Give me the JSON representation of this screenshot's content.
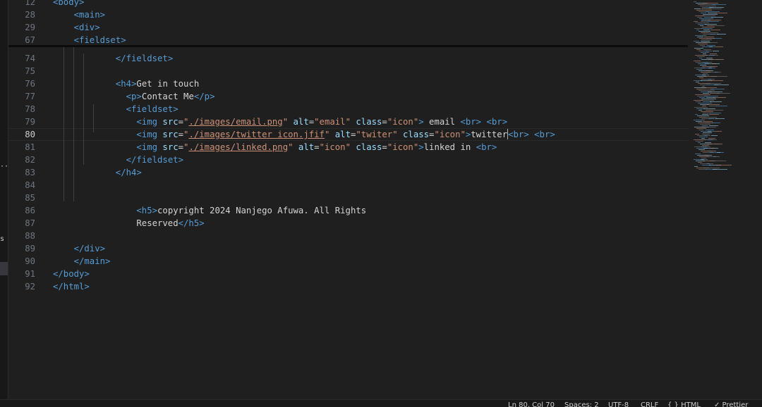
{
  "sticky_scroll": [
    {
      "ln": "12",
      "parts": [
        {
          "c": "t",
          "s": "<body>"
        }
      ]
    },
    {
      "ln": "28",
      "parts": [
        {
          "c": "t",
          "s": "<main>"
        }
      ]
    },
    {
      "ln": "29",
      "parts": [
        {
          "c": "t",
          "s": "<div>"
        }
      ]
    },
    {
      "ln": "67",
      "parts": [
        {
          "c": "t",
          "s": "<fieldset>"
        }
      ]
    }
  ],
  "lines": [
    {
      "ln": "74",
      "indent": 6,
      "parts": [
        {
          "c": "t",
          "s": "</fieldset>"
        }
      ]
    },
    {
      "ln": "75",
      "indent": 0,
      "parts": []
    },
    {
      "ln": "76",
      "indent": 6,
      "parts": [
        {
          "c": "t",
          "s": "<h4>"
        },
        {
          "c": "txt",
          "s": "Get in touch"
        }
      ]
    },
    {
      "ln": "77",
      "indent": 7,
      "parts": [
        {
          "c": "t",
          "s": "<p>"
        },
        {
          "c": "txt",
          "s": "Contact Me"
        },
        {
          "c": "t",
          "s": "</p>"
        }
      ]
    },
    {
      "ln": "78",
      "indent": 7,
      "parts": [
        {
          "c": "t",
          "s": "<fieldset>"
        }
      ]
    },
    {
      "ln": "79",
      "indent": 8,
      "parts": [
        {
          "c": "t",
          "s": "<img "
        },
        {
          "c": "a",
          "s": "src"
        },
        {
          "c": "txt",
          "s": "="
        },
        {
          "c": "v",
          "s": "\""
        },
        {
          "c": "v u",
          "s": "./images/email.png"
        },
        {
          "c": "v",
          "s": "\""
        },
        {
          "c": "a",
          "s": " alt"
        },
        {
          "c": "txt",
          "s": "="
        },
        {
          "c": "v",
          "s": "\"email\""
        },
        {
          "c": "a",
          "s": " class"
        },
        {
          "c": "txt",
          "s": "="
        },
        {
          "c": "v",
          "s": "\"icon\""
        },
        {
          "c": "t",
          "s": ">"
        },
        {
          "c": "txt",
          "s": " email "
        },
        {
          "c": "t",
          "s": "<br>"
        },
        {
          "c": "txt",
          "s": " "
        },
        {
          "c": "t",
          "s": "<br>"
        }
      ]
    },
    {
      "ln": "80",
      "indent": 8,
      "active": true,
      "parts": [
        {
          "c": "t",
          "s": "<img "
        },
        {
          "c": "a",
          "s": "src"
        },
        {
          "c": "txt",
          "s": "="
        },
        {
          "c": "v",
          "s": "\""
        },
        {
          "c": "v u",
          "s": "./images/twitter icon.jfif"
        },
        {
          "c": "v",
          "s": "\""
        },
        {
          "c": "a",
          "s": " alt"
        },
        {
          "c": "txt",
          "s": "="
        },
        {
          "c": "v",
          "s": "\"twiter\""
        },
        {
          "c": "a",
          "s": " class"
        },
        {
          "c": "txt",
          "s": "="
        },
        {
          "c": "v",
          "s": "\"icon\""
        },
        {
          "c": "t",
          "s": ">"
        },
        {
          "c": "txt",
          "s": "twitter"
        },
        {
          "c": "cursor",
          "s": ""
        },
        {
          "c": "t",
          "s": "<br>"
        },
        {
          "c": "txt",
          "s": " "
        },
        {
          "c": "t",
          "s": "<br>"
        }
      ]
    },
    {
      "ln": "81",
      "indent": 8,
      "parts": [
        {
          "c": "t",
          "s": "<img "
        },
        {
          "c": "a",
          "s": "src"
        },
        {
          "c": "txt",
          "s": "="
        },
        {
          "c": "v",
          "s": "\""
        },
        {
          "c": "v u",
          "s": "./images/linked.png"
        },
        {
          "c": "v",
          "s": "\""
        },
        {
          "c": "a",
          "s": " alt"
        },
        {
          "c": "txt",
          "s": "="
        },
        {
          "c": "v",
          "s": "\"icon\""
        },
        {
          "c": "a",
          "s": " class"
        },
        {
          "c": "txt",
          "s": "="
        },
        {
          "c": "v",
          "s": "\"icon\""
        },
        {
          "c": "t",
          "s": ">"
        },
        {
          "c": "txt",
          "s": "linked in "
        },
        {
          "c": "t",
          "s": "<br>"
        }
      ]
    },
    {
      "ln": "82",
      "indent": 7,
      "parts": [
        {
          "c": "t",
          "s": "</fieldset>"
        }
      ]
    },
    {
      "ln": "83",
      "indent": 6,
      "parts": [
        {
          "c": "t",
          "s": "</h4>"
        }
      ]
    },
    {
      "ln": "84",
      "indent": 0,
      "parts": []
    },
    {
      "ln": "85",
      "indent": 0,
      "parts": []
    },
    {
      "ln": "86",
      "indent": 8,
      "parts": [
        {
          "c": "t",
          "s": "<h5>"
        },
        {
          "c": "txt",
          "s": "copyright 2024 Nanjego Afuwa. All Rights"
        }
      ]
    },
    {
      "ln": "87",
      "indent": 8,
      "parts": [
        {
          "c": "txt",
          "s": "Reserved"
        },
        {
          "c": "t",
          "s": "</h5>"
        }
      ]
    },
    {
      "ln": "88",
      "indent": 0,
      "parts": []
    },
    {
      "ln": "89",
      "indent": 2,
      "parts": [
        {
          "c": "t",
          "s": "</div>"
        }
      ]
    },
    {
      "ln": "90",
      "indent": 2,
      "parts": [
        {
          "c": "t",
          "s": "</main>"
        }
      ]
    },
    {
      "ln": "91",
      "indent": 0,
      "parts": [
        {
          "c": "t",
          "s": "</body>"
        }
      ]
    },
    {
      "ln": "92",
      "indent": 0,
      "parts": [
        {
          "c": "t",
          "s": "</html>"
        }
      ]
    }
  ],
  "status_bar": {
    "position": "Ln 80, Col 70",
    "spaces": "Spaces: 2",
    "encoding": "UTF-8",
    "eol": "CRLF",
    "language": "{ } HTML",
    "prettier": "✓ Prettier"
  },
  "colors": {
    "background": "#1f1f1f",
    "tag": "#569cd6",
    "attribute": "#9cdcfe",
    "string": "#ce9178",
    "text": "#d4d4d4",
    "line_number": "#6e7681"
  }
}
